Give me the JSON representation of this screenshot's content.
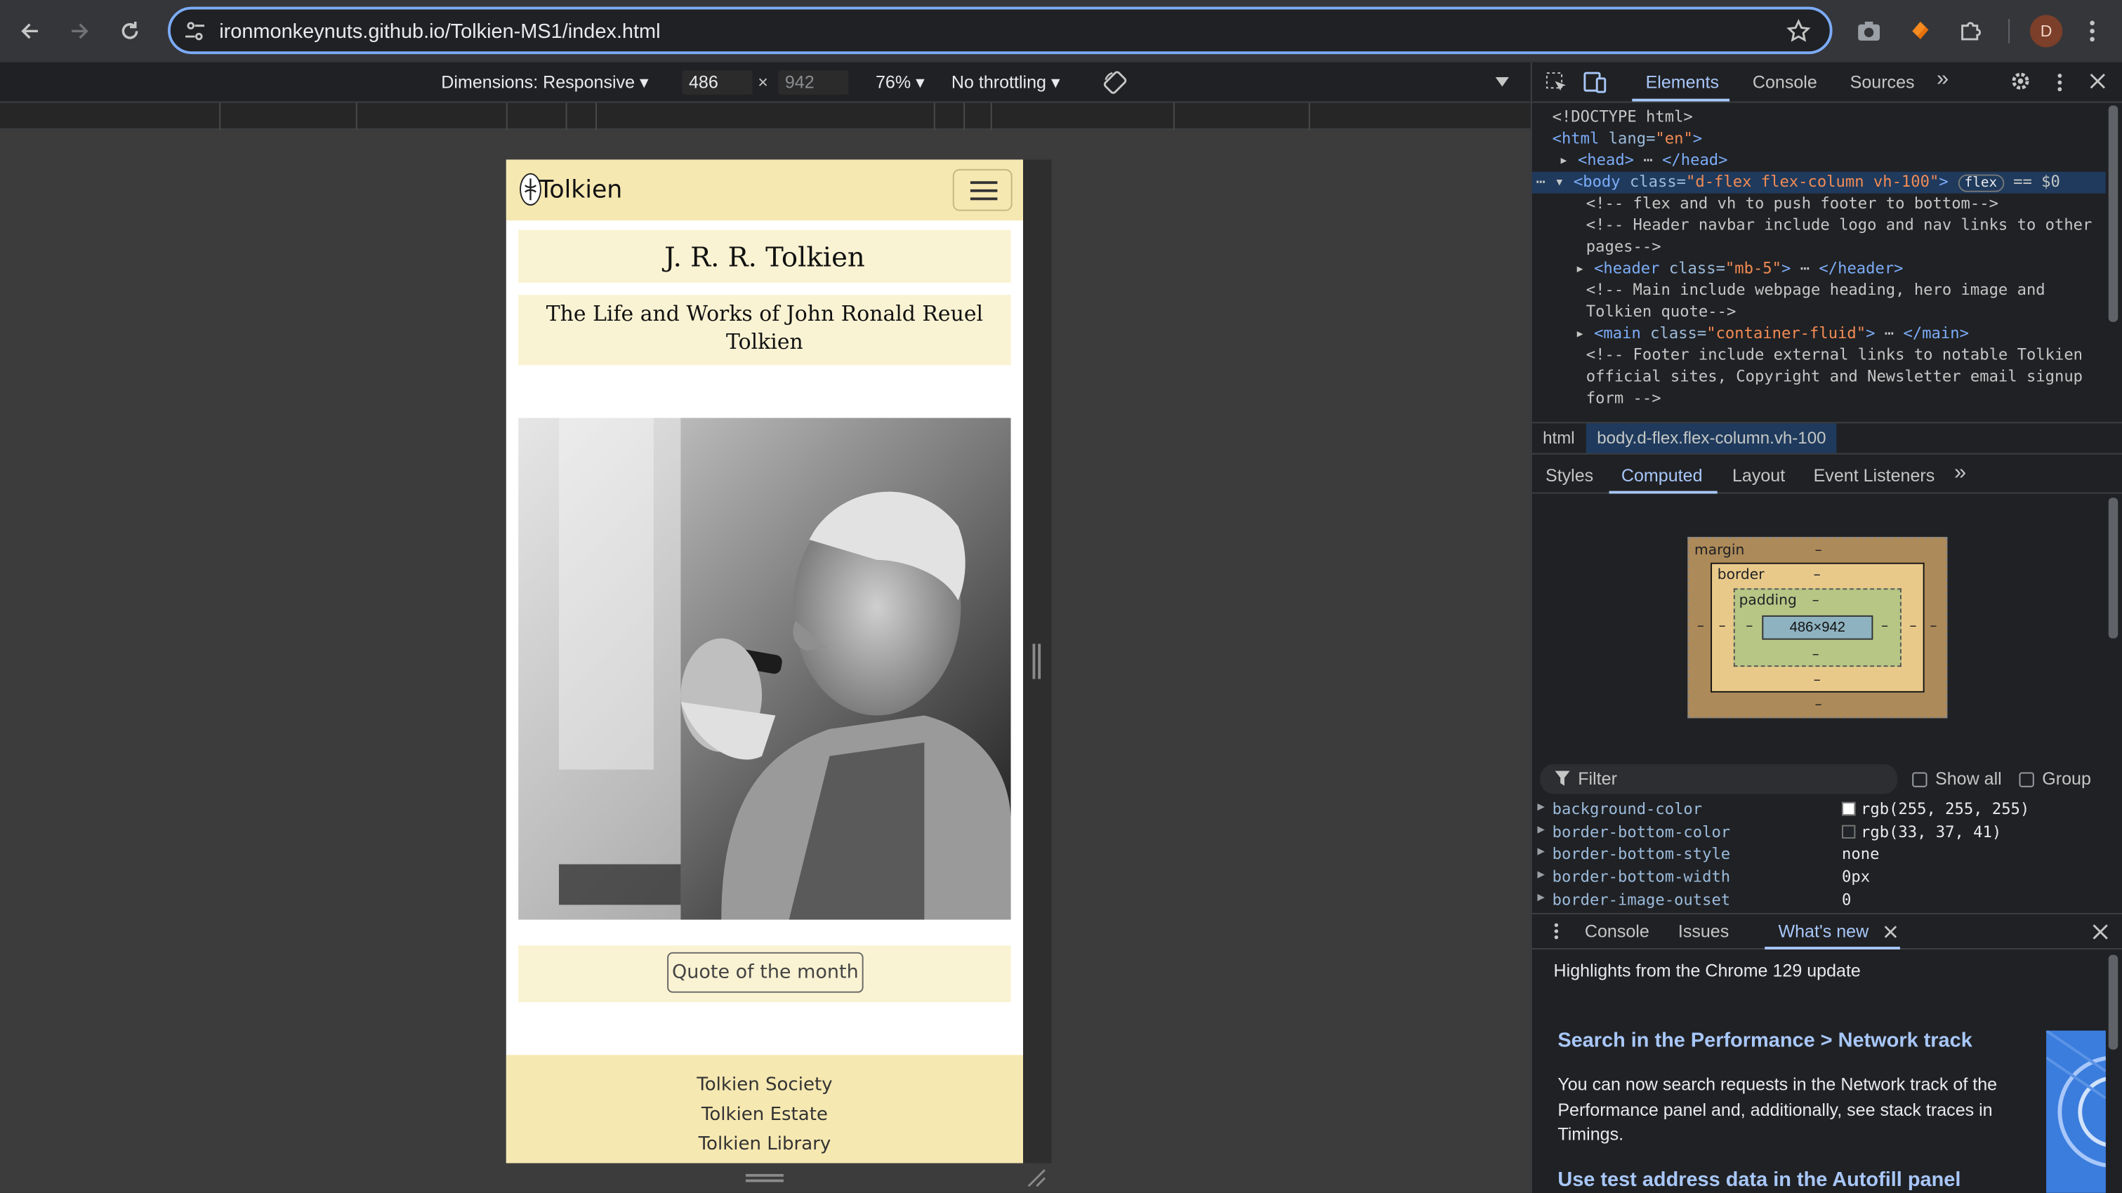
{
  "browser": {
    "url": "ironmonkeynuts.github.io/Tolkien-MS1/index.html",
    "profile_initial": "D",
    "icons": [
      "back-icon",
      "forward-icon",
      "reload-icon",
      "site-settings-icon",
      "bookmark-star-icon",
      "screenshot-icon",
      "extension-icon",
      "puzzle-icon",
      "more-icon"
    ]
  },
  "device_toolbar": {
    "dimensions_label": "Dimensions: Responsive ▾",
    "width": "486",
    "height": "942",
    "zoom": "76% ▾",
    "throttling": "No throttling ▾"
  },
  "site": {
    "brand": "Tolkien",
    "title": "J. R. R. Tolkien",
    "subtitle": "The Life and Works of John Ronald Reuel Tolkien",
    "quote_button": "Quote of the month",
    "footer_links": [
      "Tolkien Society",
      "Tolkien Estate",
      "Tolkien Library"
    ]
  },
  "devtools": {
    "tabs": [
      "Elements",
      "Console",
      "Sources"
    ],
    "more_tabs": "»",
    "dom": {
      "l1": "<!DOCTYPE html>",
      "l2_tag": "<html",
      "l2_attr": " lang=",
      "l2_val": "\"en\"",
      "l2_end": ">",
      "l3": "<head>",
      "l3_end": "</head>",
      "l4_tag": "<body",
      "l4_attr": " class=",
      "l4_val": "\"d-flex flex-column vh-100\"",
      "l4_end": ">",
      "l4_badge": "flex",
      "l4_eq": "== $0",
      "c1": "<!-- flex and vh to push footer to bottom-->",
      "c2a": "<!-- Header navbar include logo and nav links to other",
      "c2b": "pages-->",
      "l5_tag": "<header",
      "l5_attr": " class=",
      "l5_val": "\"mb-5\"",
      "l5_end": "</header>",
      "c3a": "<!-- Main include webpage heading, hero image and",
      "c3b": "Tolkien quote-->",
      "l6_tag": "<main",
      "l6_attr": " class=",
      "l6_val": "\"container-fluid\"",
      "l6_end": "</main>",
      "c4a": "<!-- Footer include external links to notable Tolkien",
      "c4b": "official sites, Copyright and Newsletter email signup",
      "c4c": "form -->"
    },
    "breadcrumbs": [
      "html",
      "body.d-flex.flex-column.vh-100"
    ],
    "sub_tabs": [
      "Styles",
      "Computed",
      "Layout",
      "Event Listeners"
    ],
    "box_model": {
      "margin": "margin",
      "border": "border",
      "padding": "padding",
      "content": "486×942",
      "dash": "–"
    },
    "filter": {
      "placeholder": "Filter",
      "show_all": "Show all",
      "group": "Group"
    },
    "computed": [
      {
        "name": "background-color",
        "value": "rgb(255, 255, 255)",
        "swatch": "#ffffff"
      },
      {
        "name": "border-bottom-color",
        "value": "rgb(33, 37, 41)",
        "swatch": "#212529"
      },
      {
        "name": "border-bottom-style",
        "value": "none"
      },
      {
        "name": "border-bottom-width",
        "value": "0px"
      },
      {
        "name": "border-image-outset",
        "value": "0"
      }
    ],
    "drawer_tabs": [
      "Console",
      "Issues",
      "What's new"
    ],
    "whats_new": {
      "intro": "Highlights from the Chrome 129 update",
      "h1": "Search in the Performance > Network track",
      "p1": "You can now search requests in the Network track of the Performance panel and, additionally, see stack traces in Timings.",
      "h2": "Use test address data in the Autofill panel"
    }
  }
}
